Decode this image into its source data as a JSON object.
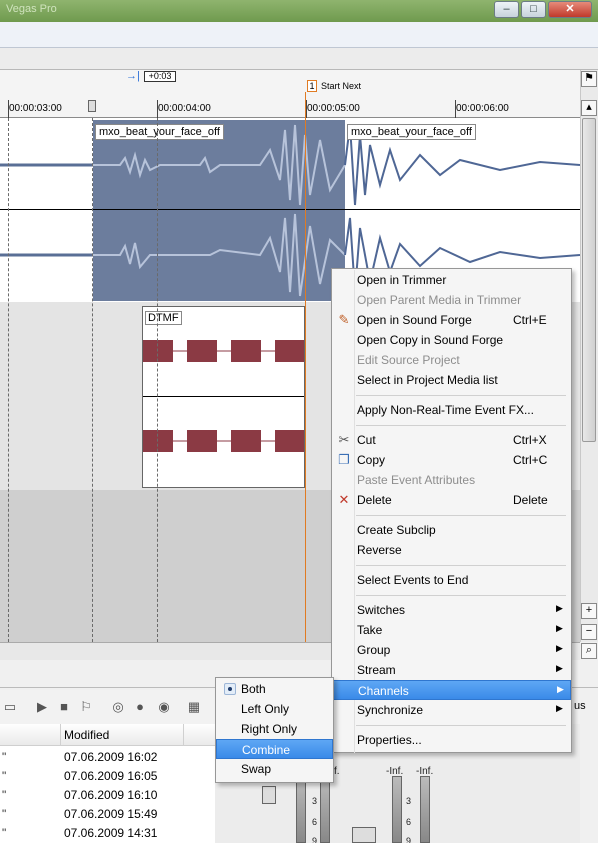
{
  "window": {
    "title": "Vegas Pro",
    "minimize": "–",
    "restore": "□",
    "close": "✕"
  },
  "timeline": {
    "loop_length": "+0:03",
    "marker": {
      "number": "1",
      "label": "Start Next"
    },
    "ticks": [
      "00:00:03:00",
      "00:00:04:00",
      "00:00:05:00",
      "00:00:06:00"
    ],
    "audio_events": [
      {
        "name": "mxo_beat_your_face_off"
      },
      {
        "name": "mxo_beat_your_face_off"
      }
    ],
    "midi_event": "DTMF"
  },
  "colors": {
    "accent": "#3a8ae8",
    "cursor": "#e07b23",
    "selected_event": "#6c7d9d",
    "dtmf_block": "#8b3a44"
  },
  "context_menu": {
    "items": [
      {
        "label": "Open in Trimmer",
        "shortcut": "",
        "disabled": false,
        "icon": "",
        "submenu": false
      },
      {
        "label": "Open Parent Media in Trimmer",
        "shortcut": "",
        "disabled": true,
        "icon": "",
        "submenu": false
      },
      {
        "label": "Open in Sound Forge",
        "shortcut": "Ctrl+E",
        "disabled": false,
        "icon": "sound-forge-icon",
        "submenu": false
      },
      {
        "label": "Open Copy in Sound Forge",
        "shortcut": "",
        "disabled": false,
        "icon": "",
        "submenu": false
      },
      {
        "label": "Edit Source Project",
        "shortcut": "",
        "disabled": true,
        "icon": "",
        "submenu": false
      },
      {
        "label": "Select in Project Media list",
        "shortcut": "",
        "disabled": false,
        "icon": "",
        "submenu": false
      },
      {
        "label": "Apply Non-Real-Time Event FX...",
        "shortcut": "",
        "disabled": false,
        "icon": "",
        "submenu": false
      },
      {
        "label": "Cut",
        "shortcut": "Ctrl+X",
        "disabled": false,
        "icon": "scissors-icon",
        "submenu": false
      },
      {
        "label": "Copy",
        "shortcut": "Ctrl+C",
        "disabled": false,
        "icon": "copy-icon",
        "submenu": false
      },
      {
        "label": "Paste Event Attributes",
        "shortcut": "",
        "disabled": true,
        "icon": "",
        "submenu": false
      },
      {
        "label": "Delete",
        "shortcut": "Delete",
        "disabled": false,
        "icon": "delete-icon",
        "submenu": false
      },
      {
        "label": "Create Subclip",
        "shortcut": "",
        "disabled": false,
        "icon": "",
        "submenu": false
      },
      {
        "label": "Reverse",
        "shortcut": "",
        "disabled": false,
        "icon": "",
        "submenu": false
      },
      {
        "label": "Select Events to End",
        "shortcut": "",
        "disabled": false,
        "icon": "",
        "submenu": false
      },
      {
        "label": "Switches",
        "shortcut": "",
        "disabled": false,
        "icon": "",
        "submenu": true
      },
      {
        "label": "Take",
        "shortcut": "",
        "disabled": false,
        "icon": "",
        "submenu": true
      },
      {
        "label": "Group",
        "shortcut": "",
        "disabled": false,
        "icon": "",
        "submenu": true
      },
      {
        "label": "Stream",
        "shortcut": "",
        "disabled": false,
        "icon": "",
        "submenu": true
      },
      {
        "label": "Channels",
        "shortcut": "",
        "disabled": false,
        "icon": "",
        "submenu": true,
        "highlighted": true
      },
      {
        "label": "Synchronize",
        "shortcut": "",
        "disabled": false,
        "icon": "",
        "submenu": true
      },
      {
        "label": "Properties...",
        "shortcut": "",
        "disabled": false,
        "icon": "",
        "submenu": false
      }
    ]
  },
  "channels_submenu": {
    "items": [
      {
        "label": "Both",
        "checked": true
      },
      {
        "label": "Left Only"
      },
      {
        "label": "Right Only"
      },
      {
        "label": "Combine",
        "highlighted": true
      },
      {
        "label": "Swap"
      }
    ]
  },
  "explorer": {
    "column_modified": "Modified",
    "rows": [
      {
        "prefix": "\"",
        "modified": "07.06.2009 16:02"
      },
      {
        "prefix": "\"",
        "modified": "07.06.2009 16:05"
      },
      {
        "prefix": "\"",
        "modified": "07.06.2009 16:10"
      },
      {
        "prefix": "\"",
        "modified": "07.06.2009 15:49"
      },
      {
        "prefix": "\"",
        "modified": "07.06.2009 14:31"
      }
    ]
  },
  "mixer": {
    "inf_left": "-Inf.",
    "inf_right": "-Inf.",
    "inf_partial": "f.",
    "scale": [
      "3",
      "6",
      "9"
    ],
    "partial_right": "us"
  }
}
